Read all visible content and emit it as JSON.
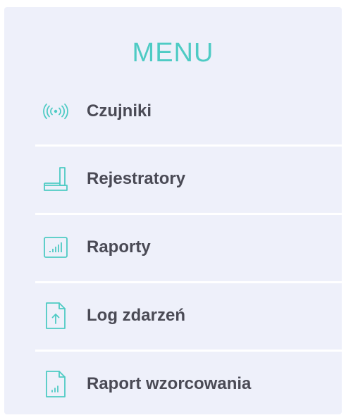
{
  "menu": {
    "title": "MENU",
    "accent_color": "#4ecbc4",
    "items": [
      {
        "label": "Czujniki",
        "icon": "sensor-signal-icon"
      },
      {
        "label": "Rejestratory",
        "icon": "recorder-icon"
      },
      {
        "label": "Raporty",
        "icon": "report-chart-icon"
      },
      {
        "label": "Log zdarzeń",
        "icon": "event-log-file-icon"
      },
      {
        "label": "Raport wzorcowania",
        "icon": "calibration-report-file-icon"
      }
    ]
  }
}
